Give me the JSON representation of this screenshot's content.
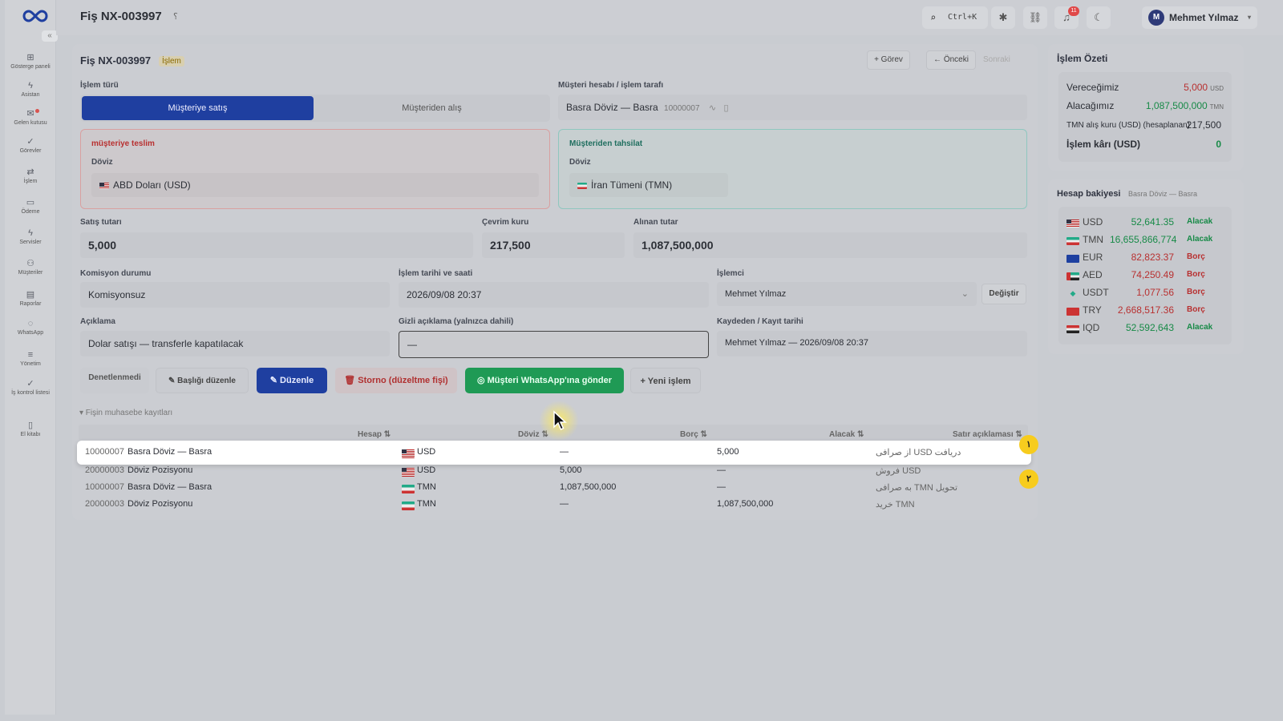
{
  "app": {
    "title": "Fiş NX-003997",
    "title_suffix": "؟"
  },
  "sidebar": {
    "collapse": "«",
    "items": [
      {
        "label": "Gösterge paneli",
        "icon": "grid-icon",
        "glyph": "⊞"
      },
      {
        "label": "Asistan",
        "icon": "lightning-icon",
        "glyph": "ϟ"
      },
      {
        "label": "Gelen kutusu",
        "icon": "inbox-icon",
        "glyph": "✉"
      },
      {
        "label": "Görevler",
        "icon": "check-icon",
        "glyph": "✓"
      },
      {
        "label": "İşlem",
        "icon": "transfer-icon",
        "glyph": "⇄"
      },
      {
        "label": "Ödeme",
        "icon": "payment-icon",
        "glyph": "▭"
      },
      {
        "label": "Servisler",
        "icon": "services-icon",
        "glyph": "ϟ"
      },
      {
        "label": "Müşteriler",
        "icon": "customers-icon",
        "glyph": "⚇"
      },
      {
        "label": "Raporlar",
        "icon": "reports-icon",
        "glyph": "▤"
      },
      {
        "label": "WhatsApp",
        "icon": "whatsapp-icon",
        "glyph": "◌"
      },
      {
        "label": "Yönetim",
        "icon": "settings-icon",
        "glyph": "≡"
      },
      {
        "label": "İş kontrol listesi",
        "icon": "checklist-icon",
        "glyph": "✓"
      },
      {
        "label": "El kitabı",
        "icon": "book-icon",
        "glyph": "▯"
      }
    ]
  },
  "topbar": {
    "search_shortcut": "Ctrl+K",
    "notification_count": "11",
    "user_name": "Mehmet Yılmaz",
    "user_initial": "M"
  },
  "form": {
    "header_title": "Fiş NX-003997",
    "header_tag": "İşlem",
    "task_button": "+ Görev",
    "prev_button": "← Önceki",
    "next_button": "Sonraki",
    "transaction_type_label": "İşlem türü",
    "seg_active": "Müşteriye satış",
    "seg_inactive": "Müşteriden alış",
    "account_label": "Müşteri hesabı / işlem tarafı",
    "account_name": "Basra Döviz — Basra",
    "account_code": "10000007",
    "deliver_title": "müşteriye teslim",
    "deliver_currency_label": "Döviz",
    "deliver_currency": "ABD Doları (USD)",
    "collect_title": "Müşteriden tahsilat",
    "collect_currency_label": "Döviz",
    "collect_currency": "İran Tümeni (TMN)",
    "sale_amount_label": "Satış tutarı",
    "sale_amount": "5,000",
    "rate_label": "Çevrim kuru",
    "rate": "217,500",
    "received_label": "Alınan tutar",
    "received": "1,087,500,000",
    "commission_label": "Komisyon durumu",
    "commission": "Komisyonsuz",
    "datetime_label": "İşlem tarihi ve saati",
    "datetime": "2026/09/08 20:37",
    "operator_label": "İşlemci",
    "operator": "Mehmet Yılmaz",
    "change_button": "Değiştir",
    "description_label": "Açıklama",
    "description": "Dolar satışı — transferle kapatılacak",
    "hidden_label": "Gizli açıklama (yalnızca dahili)",
    "hidden_value": "—",
    "recorder_label": "Kaydeden / Kayıt tarihi",
    "recorder": "Mehmet Yılmaz — 2026/09/08 20:37"
  },
  "actions": {
    "status": "Denetlenmedi",
    "edit_title": "✎ Başlığı düzenle",
    "edit": "Düzenle",
    "storno": "Storno (düzeltme fişi)",
    "whatsapp": "Müşteri WhatsApp'ına gönder",
    "new": "+ Yeni işlem"
  },
  "ledger": {
    "toggle": "▾ Fişin muhasebe kayıtları",
    "headers": [
      "Hesap ⇅",
      "Döviz ⇅",
      "Borç ⇅",
      "Alacak ⇅",
      "Satır açıklaması ⇅"
    ],
    "rows": [
      {
        "code": "10000007",
        "name": "Basra Döviz — Basra",
        "flag": "us",
        "currency": "USD",
        "debit": "—",
        "credit": "5,000",
        "note": "از صرافی USD دریافت"
      },
      {
        "code": "20000003",
        "name": "Döviz Pozisyonu",
        "flag": "us",
        "currency": "USD",
        "debit": "5,000",
        "credit": "—",
        "note": "فروش USD"
      },
      {
        "code": "10000007",
        "name": "Basra Döviz — Basra",
        "flag": "ir",
        "currency": "TMN",
        "debit": "1,087,500,000",
        "credit": "—",
        "note": "به صرافی TMN تحویل"
      },
      {
        "code": "20000003",
        "name": "Döviz Pozisyonu",
        "flag": "ir",
        "currency": "TMN",
        "debit": "—",
        "credit": "1,087,500,000",
        "note": "خرید TMN"
      }
    ],
    "markers": [
      "١",
      "٢"
    ]
  },
  "summary": {
    "title": "İşlem Özeti",
    "rows": [
      {
        "label": "Vereceğimiz",
        "value": "5,000",
        "unit": "USD"
      },
      {
        "label": "Alacağımız",
        "value": "1,087,500,000",
        "unit": "TMN"
      },
      {
        "label": "TMN alış kuru (USD) (hesaplanan)",
        "value": "217,500",
        "unit": ""
      },
      {
        "label": "İşlem kârı (USD)",
        "value": "0",
        "unit": ""
      }
    ]
  },
  "balance": {
    "title": "Hesap bakiyesi",
    "subtitle": "Basra Döviz — Basra",
    "rows": [
      {
        "flag": "us",
        "currency": "USD",
        "amount": "52,641.35",
        "status": "Alacak",
        "color": "#178a47"
      },
      {
        "flag": "ir",
        "currency": "TMN",
        "amount": "16,655,866,774",
        "status": "Alacak",
        "color": "#178a47"
      },
      {
        "flag": "eu",
        "currency": "EUR",
        "amount": "82,823.37",
        "status": "Borç",
        "color": "#b83030"
      },
      {
        "flag": "ae",
        "currency": "AED",
        "amount": "74,250.49",
        "status": "Borç",
        "color": "#b83030"
      },
      {
        "flag": "usdt",
        "currency": "USDT",
        "amount": "1,077.56",
        "status": "Borç",
        "color": "#b83030"
      },
      {
        "flag": "tr",
        "currency": "TRY",
        "amount": "2,668,517.36",
        "status": "Borç",
        "color": "#b83030"
      },
      {
        "flag": "iq",
        "currency": "IQD",
        "amount": "52,592,643",
        "status": "Alacak",
        "color": "#178a47"
      }
    ]
  }
}
